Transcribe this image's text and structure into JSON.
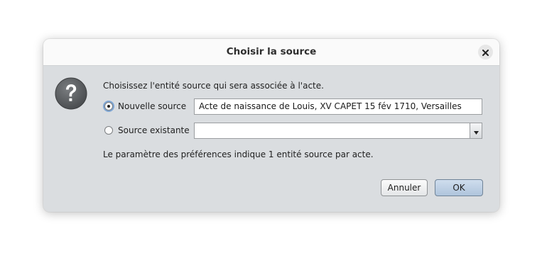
{
  "dialog": {
    "title": "Choisir la source",
    "close_icon": "close-icon",
    "question_icon": "question-icon",
    "prompt": "Choisissez l'entité source qui sera associée à l'acte.",
    "new_source": {
      "label": "Nouvelle source",
      "selected": true,
      "value": "Acte de naissance de Louis, XV CAPET 15 fév 1710, Versailles"
    },
    "existing_source": {
      "label": "Source existante",
      "selected": false,
      "value": ""
    },
    "info": "Le paramètre des préférences indique 1 entité source par acte.",
    "buttons": {
      "cancel": "Annuler",
      "ok": "OK"
    }
  }
}
